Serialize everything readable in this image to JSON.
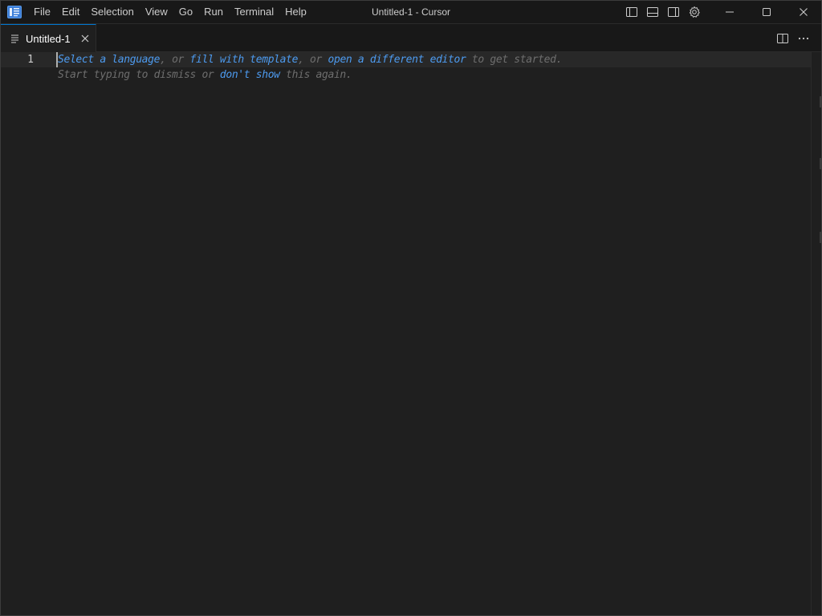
{
  "titlebar": {
    "menu": [
      "File",
      "Edit",
      "Selection",
      "View",
      "Go",
      "Run",
      "Terminal",
      "Help"
    ],
    "window_title": "Untitled-1 - Cursor",
    "accent": "#0078d4"
  },
  "tabs": [
    {
      "label": "Untitled-1",
      "active": true,
      "icon": "file-lines-icon"
    }
  ],
  "editor": {
    "line_numbers": [
      "1"
    ],
    "hint_line1": {
      "link1": "Select a language",
      "sep1": ", or ",
      "link2": "fill with template",
      "sep2": ", or ",
      "link3": "open a different editor",
      "tail": " to get started."
    },
    "hint_line2": {
      "head": "Start typing to dismiss or ",
      "link": "don't show",
      "tail": " this again."
    },
    "link_color": "#4d9bf0",
    "hint_color": "#6e6e6e"
  }
}
